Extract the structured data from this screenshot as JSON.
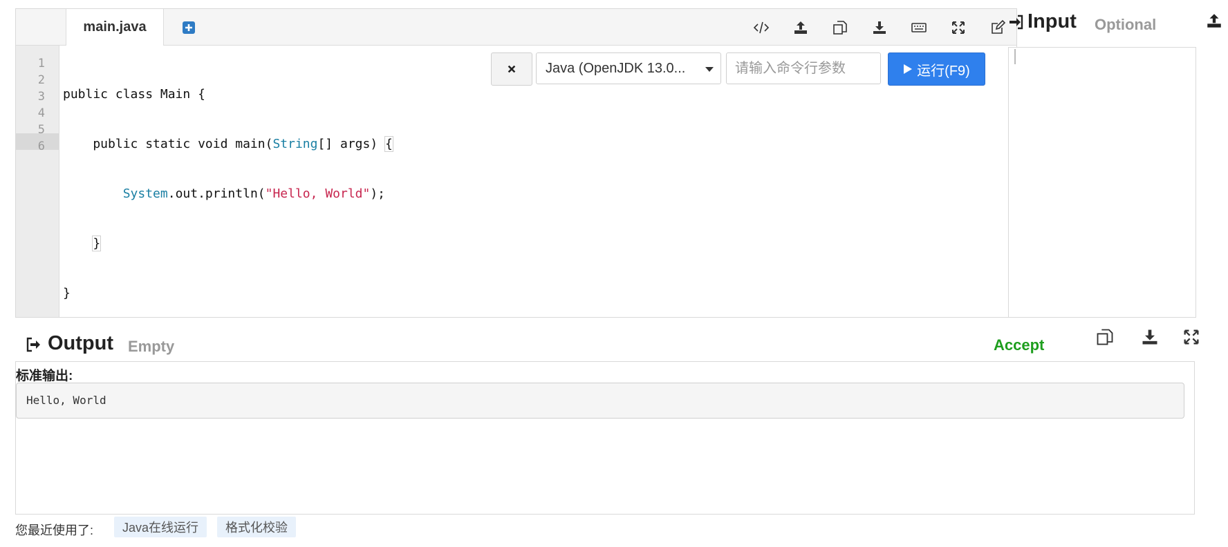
{
  "editor": {
    "tab_label": "main.java",
    "line_numbers": [
      "1",
      "2",
      "3",
      "4",
      "5",
      "6"
    ],
    "code_lines": [
      "public class Main {",
      "    public static void main(String[] args) {",
      "        System.out.println(\"Hello, World\");",
      "    }",
      "}",
      ""
    ],
    "toolbar_icons": [
      "code-icon",
      "upload-icon",
      "copy-icon",
      "download-icon",
      "keyboard-icon",
      "fullscreen-icon",
      "edit-icon"
    ]
  },
  "runbar": {
    "clear_icon": "close-icon",
    "language_selected": "Java (OpenJDK 13.0...",
    "args_placeholder": "请输入命令行参数",
    "args_value": "",
    "run_label": "运行(F9)",
    "run_color": "#2f80ed"
  },
  "input_panel": {
    "title": "Input",
    "subtitle": "Optional",
    "value": ""
  },
  "output_panel": {
    "title": "Output",
    "subtitle": "Empty",
    "status": "Accept",
    "status_color": "#1e9e1e",
    "stdout_label": "标准输出:",
    "stdout_value": "Hello, World"
  },
  "recent": {
    "label": "您最近使用了:",
    "items": [
      "Java在线运行",
      "格式化校验"
    ]
  }
}
